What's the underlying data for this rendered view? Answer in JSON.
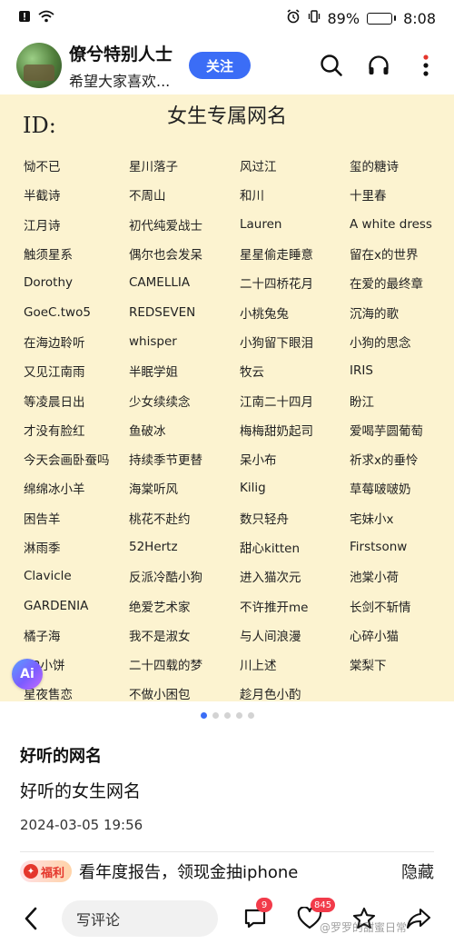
{
  "status_bar": {
    "battery_percent": "89%",
    "time": "8:08",
    "battery_level": 0.89
  },
  "header": {
    "user_name": "僚兮特别人士",
    "user_subtitle": "希望大家喜欢...",
    "follow_label": "关注"
  },
  "image": {
    "title": "女生专属网名",
    "id_label": "ID:",
    "names": [
      "恸不已",
      "星川落子",
      "风过江",
      "玺的糖诗",
      "半截诗",
      "不周山",
      "和川",
      "十里春",
      "江月诗",
      "初代纯爱战士",
      "Lauren",
      "A white dress",
      "触须星系",
      "偶尔也会发呆",
      "星星偷走睡意",
      "留在x的世界",
      "Dorothy",
      "CAMELLIA",
      "二十四桥花月",
      "在爱的最终章",
      "GoeC.two5",
      "REDSEVEN",
      "小桃兔兔",
      "沉海的歌",
      "在海边聆听",
      "whisper",
      "小狗留下眼泪",
      "小狗的思念",
      "又见江南雨",
      "半眠学姐",
      "牧云",
      "IRIS",
      "等凌晨日出",
      "少女续续念",
      "江南二十四月",
      "盼江",
      "才没有脸红",
      "鱼破冰",
      "梅梅甜奶起司",
      "爱喝芋圆葡萄",
      "今天会画卧蚕吗",
      "持续季节更替",
      "呆小布",
      "祈求x的垂怜",
      "绵绵冰小羊",
      "海棠听风",
      "Kilig",
      "草莓啵啵奶",
      "困告羊",
      "桃花不赴约",
      "数只轻舟",
      "宅妹小x",
      "淋雨季",
      "52Hertz",
      "甜心kitten",
      "Firstsonw",
      "Clavicle",
      "反派冷酷小狗",
      "进入猫次元",
      "池棠小荷",
      "GARDENIA",
      "绝爱艺术家",
      "不许推开me",
      "长剑不斩情",
      "橘子海",
      "我不是淑女",
      "与人间浪漫",
      "心碎小猫",
      "BB小饼",
      "二十四载的梦",
      "川上述",
      "棠梨下",
      "星夜售恋",
      "不做小困包",
      "趁月色小酌",
      ""
    ]
  },
  "ai_badge": "Ai",
  "carousel": {
    "total": 5,
    "active": 0
  },
  "post": {
    "title": "好听的网名",
    "subtitle": "好听的女生网名",
    "date": "2024-03-05 19:56"
  },
  "promo": {
    "badge": "福利",
    "text": "看年度报告，领现金抽iphone",
    "hide_label": "隐藏"
  },
  "bottom_bar": {
    "comment_placeholder": "写评论",
    "comment_count": "9",
    "like_count": "845"
  },
  "watermark": "@罗罗的甜蜜日常"
}
